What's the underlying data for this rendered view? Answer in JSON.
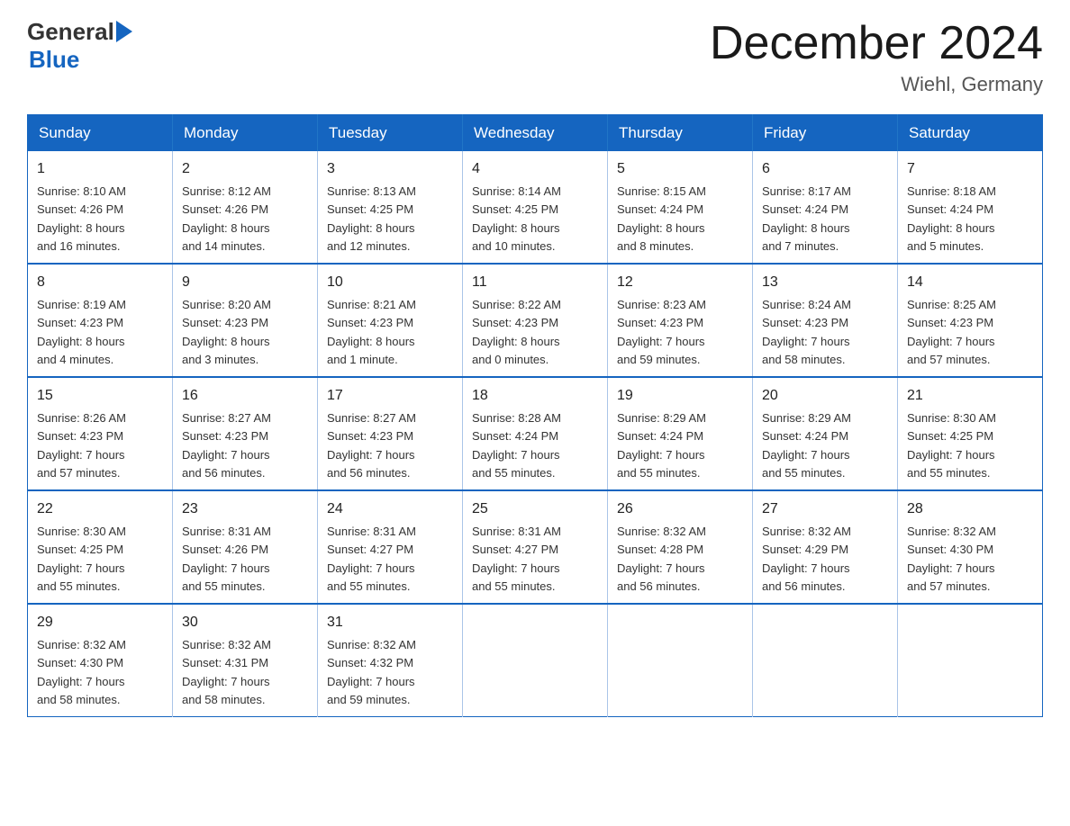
{
  "header": {
    "logo_general": "General",
    "logo_blue": "Blue",
    "title": "December 2024",
    "location": "Wiehl, Germany"
  },
  "days_of_week": [
    "Sunday",
    "Monday",
    "Tuesday",
    "Wednesday",
    "Thursday",
    "Friday",
    "Saturday"
  ],
  "weeks": [
    [
      {
        "day": "1",
        "sunrise": "8:10 AM",
        "sunset": "4:26 PM",
        "daylight": "8 hours and 16 minutes."
      },
      {
        "day": "2",
        "sunrise": "8:12 AM",
        "sunset": "4:26 PM",
        "daylight": "8 hours and 14 minutes."
      },
      {
        "day": "3",
        "sunrise": "8:13 AM",
        "sunset": "4:25 PM",
        "daylight": "8 hours and 12 minutes."
      },
      {
        "day": "4",
        "sunrise": "8:14 AM",
        "sunset": "4:25 PM",
        "daylight": "8 hours and 10 minutes."
      },
      {
        "day": "5",
        "sunrise": "8:15 AM",
        "sunset": "4:24 PM",
        "daylight": "8 hours and 8 minutes."
      },
      {
        "day": "6",
        "sunrise": "8:17 AM",
        "sunset": "4:24 PM",
        "daylight": "8 hours and 7 minutes."
      },
      {
        "day": "7",
        "sunrise": "8:18 AM",
        "sunset": "4:24 PM",
        "daylight": "8 hours and 5 minutes."
      }
    ],
    [
      {
        "day": "8",
        "sunrise": "8:19 AM",
        "sunset": "4:23 PM",
        "daylight": "8 hours and 4 minutes."
      },
      {
        "day": "9",
        "sunrise": "8:20 AM",
        "sunset": "4:23 PM",
        "daylight": "8 hours and 3 minutes."
      },
      {
        "day": "10",
        "sunrise": "8:21 AM",
        "sunset": "4:23 PM",
        "daylight": "8 hours and 1 minute."
      },
      {
        "day": "11",
        "sunrise": "8:22 AM",
        "sunset": "4:23 PM",
        "daylight": "8 hours and 0 minutes."
      },
      {
        "day": "12",
        "sunrise": "8:23 AM",
        "sunset": "4:23 PM",
        "daylight": "7 hours and 59 minutes."
      },
      {
        "day": "13",
        "sunrise": "8:24 AM",
        "sunset": "4:23 PM",
        "daylight": "7 hours and 58 minutes."
      },
      {
        "day": "14",
        "sunrise": "8:25 AM",
        "sunset": "4:23 PM",
        "daylight": "7 hours and 57 minutes."
      }
    ],
    [
      {
        "day": "15",
        "sunrise": "8:26 AM",
        "sunset": "4:23 PM",
        "daylight": "7 hours and 57 minutes."
      },
      {
        "day": "16",
        "sunrise": "8:27 AM",
        "sunset": "4:23 PM",
        "daylight": "7 hours and 56 minutes."
      },
      {
        "day": "17",
        "sunrise": "8:27 AM",
        "sunset": "4:23 PM",
        "daylight": "7 hours and 56 minutes."
      },
      {
        "day": "18",
        "sunrise": "8:28 AM",
        "sunset": "4:24 PM",
        "daylight": "7 hours and 55 minutes."
      },
      {
        "day": "19",
        "sunrise": "8:29 AM",
        "sunset": "4:24 PM",
        "daylight": "7 hours and 55 minutes."
      },
      {
        "day": "20",
        "sunrise": "8:29 AM",
        "sunset": "4:24 PM",
        "daylight": "7 hours and 55 minutes."
      },
      {
        "day": "21",
        "sunrise": "8:30 AM",
        "sunset": "4:25 PM",
        "daylight": "7 hours and 55 minutes."
      }
    ],
    [
      {
        "day": "22",
        "sunrise": "8:30 AM",
        "sunset": "4:25 PM",
        "daylight": "7 hours and 55 minutes."
      },
      {
        "day": "23",
        "sunrise": "8:31 AM",
        "sunset": "4:26 PM",
        "daylight": "7 hours and 55 minutes."
      },
      {
        "day": "24",
        "sunrise": "8:31 AM",
        "sunset": "4:27 PM",
        "daylight": "7 hours and 55 minutes."
      },
      {
        "day": "25",
        "sunrise": "8:31 AM",
        "sunset": "4:27 PM",
        "daylight": "7 hours and 55 minutes."
      },
      {
        "day": "26",
        "sunrise": "8:32 AM",
        "sunset": "4:28 PM",
        "daylight": "7 hours and 56 minutes."
      },
      {
        "day": "27",
        "sunrise": "8:32 AM",
        "sunset": "4:29 PM",
        "daylight": "7 hours and 56 minutes."
      },
      {
        "day": "28",
        "sunrise": "8:32 AM",
        "sunset": "4:30 PM",
        "daylight": "7 hours and 57 minutes."
      }
    ],
    [
      {
        "day": "29",
        "sunrise": "8:32 AM",
        "sunset": "4:30 PM",
        "daylight": "7 hours and 58 minutes."
      },
      {
        "day": "30",
        "sunrise": "8:32 AM",
        "sunset": "4:31 PM",
        "daylight": "7 hours and 58 minutes."
      },
      {
        "day": "31",
        "sunrise": "8:32 AM",
        "sunset": "4:32 PM",
        "daylight": "7 hours and 59 minutes."
      },
      null,
      null,
      null,
      null
    ]
  ],
  "labels": {
    "sunrise": "Sunrise:",
    "sunset": "Sunset:",
    "daylight": "Daylight:"
  }
}
